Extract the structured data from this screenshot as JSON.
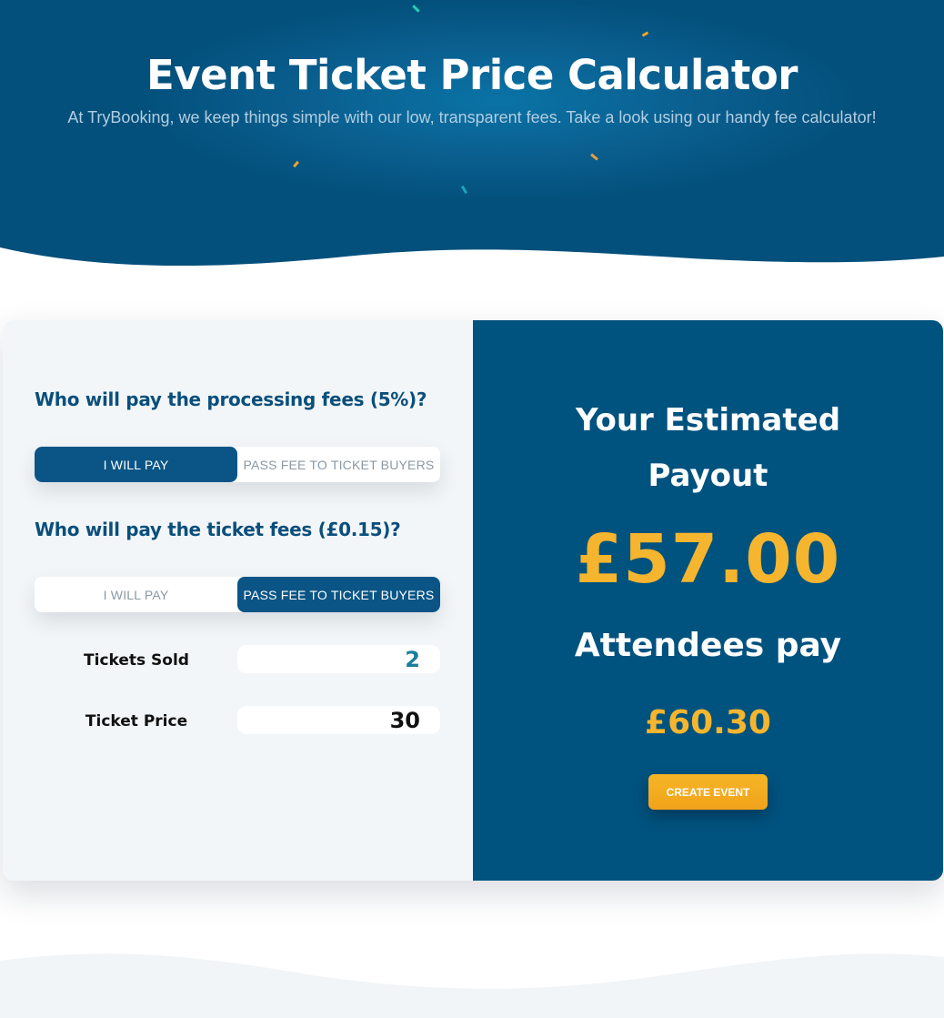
{
  "hero": {
    "title": "Event Ticket Price Calculator",
    "subtitle": "At TryBooking, we keep things simple with our low, transparent fees. Take a look using our handy fee calculator!"
  },
  "calculator": {
    "processing_fee": {
      "question": "Who will pay the processing fees (5%)?",
      "options": [
        "I WILL PAY",
        "PASS FEE TO TICKET BUYERS"
      ],
      "selected": "I WILL PAY"
    },
    "ticket_fee": {
      "question": "Who will pay the ticket fees (£0.15)?",
      "options": [
        "I WILL PAY",
        "PASS FEE TO TICKET BUYERS"
      ],
      "selected": "PASS FEE TO TICKET BUYERS"
    },
    "tickets_sold": {
      "label": "Tickets Sold",
      "value": "2"
    },
    "ticket_price": {
      "label": "Ticket Price",
      "value": "30"
    }
  },
  "results": {
    "payout_heading_line1": "Your Estimated",
    "payout_heading_line2": "Payout",
    "payout_value": "£57.00",
    "attendees_heading": "Attendees pay",
    "attendees_value": "£60.30",
    "cta_label": "CREATE EVENT"
  },
  "colors": {
    "brand_blue": "#00527f",
    "accent_orange": "#f5b52e",
    "question_text": "#0a4f7c",
    "panel_bg": "#f3f6f8",
    "tickets_sold_text": "#1a7f9a"
  }
}
